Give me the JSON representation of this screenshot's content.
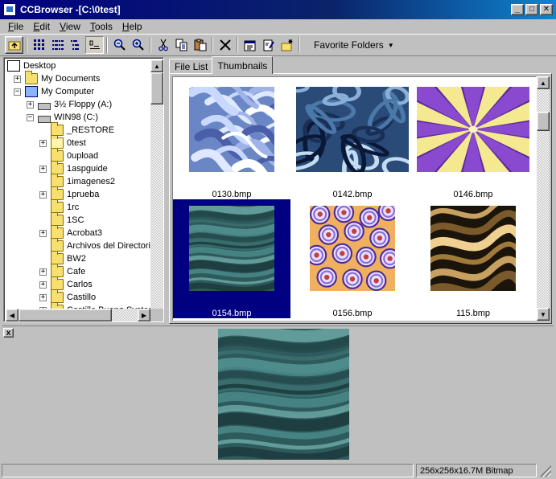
{
  "window": {
    "title": "CCBrowser -[C:\\0test]"
  },
  "caption_buttons": {
    "minimize": "_",
    "maximize": "□",
    "close": "✕"
  },
  "menu": [
    {
      "label": "File",
      "accel": "F",
      "rest": "ile"
    },
    {
      "label": "Edit",
      "accel": "E",
      "rest": "dit"
    },
    {
      "label": "View",
      "accel": "V",
      "rest": "iew"
    },
    {
      "label": "Tools",
      "accel": "T",
      "rest": "ools"
    },
    {
      "label": "Help",
      "accel": "H",
      "rest": "elp"
    }
  ],
  "toolbar": {
    "icons": [
      "up-folder-icon",
      "large-icons-icon",
      "small-icons-icon",
      "list-icon",
      "details-icon",
      "zoom-out-icon",
      "zoom-in-icon",
      "cut-icon",
      "copy-icon",
      "paste-icon",
      "delete-icon",
      "properties-icon",
      "rename-icon",
      "new-folder-icon"
    ],
    "favorites_label": "Favorite Folders"
  },
  "tree": {
    "items": [
      {
        "label": "Desktop",
        "level": 0,
        "expander": "",
        "icon": "desktop-icon"
      },
      {
        "label": "My Documents",
        "level": 1,
        "expander": "+",
        "icon": "folder-icon"
      },
      {
        "label": "My Computer",
        "level": 1,
        "expander": "−",
        "icon": "computer-icon"
      },
      {
        "label": "3½ Floppy (A:)",
        "level": 2,
        "expander": "+",
        "icon": "floppy-icon"
      },
      {
        "label": "WIN98 (C:)",
        "level": 2,
        "expander": "−",
        "icon": "drive-icon"
      },
      {
        "label": "_RESTORE",
        "level": 3,
        "expander": "",
        "icon": "folder-icon"
      },
      {
        "label": "0test",
        "level": 3,
        "expander": "+",
        "icon": "folder-open-icon"
      },
      {
        "label": "0upload",
        "level": 3,
        "expander": "",
        "icon": "folder-icon"
      },
      {
        "label": "1aspguide",
        "level": 3,
        "expander": "+",
        "icon": "folder-icon"
      },
      {
        "label": "1imagenes2",
        "level": 3,
        "expander": "",
        "icon": "folder-icon"
      },
      {
        "label": "1prueba",
        "level": 3,
        "expander": "+",
        "icon": "folder-icon"
      },
      {
        "label": "1rc",
        "level": 3,
        "expander": "",
        "icon": "folder-icon"
      },
      {
        "label": "1SC",
        "level": 3,
        "expander": "",
        "icon": "folder-icon"
      },
      {
        "label": "Acrobat3",
        "level": 3,
        "expander": "+",
        "icon": "folder-icon"
      },
      {
        "label": "Archivos del Directori",
        "level": 3,
        "expander": "",
        "icon": "folder-icon"
      },
      {
        "label": "BW2",
        "level": 3,
        "expander": "",
        "icon": "folder-icon"
      },
      {
        "label": "Cafe",
        "level": 3,
        "expander": "+",
        "icon": "folder-icon"
      },
      {
        "label": "Carlos",
        "level": 3,
        "expander": "+",
        "icon": "folder-icon"
      },
      {
        "label": "Castillo",
        "level": 3,
        "expander": "+",
        "icon": "folder-icon"
      },
      {
        "label": "Castillo Bueno Systen",
        "level": 3,
        "expander": "+",
        "icon": "folder-icon"
      }
    ]
  },
  "tabs": [
    {
      "label": "File List",
      "active": false
    },
    {
      "label": "Thumbnails",
      "active": true
    }
  ],
  "thumbnails": [
    {
      "filename": "0130.bmp",
      "pattern": "swirl-white",
      "selected": false
    },
    {
      "filename": "0142.bmp",
      "pattern": "swirl-blue",
      "selected": false
    },
    {
      "filename": "0146.bmp",
      "pattern": "star-purple",
      "selected": false
    },
    {
      "filename": "0154.bmp",
      "pattern": "teal-marble",
      "selected": true
    },
    {
      "filename": "0156.bmp",
      "pattern": "circles-orange",
      "selected": false
    },
    {
      "filename": "115.bmp",
      "pattern": "gold-waves",
      "selected": false
    }
  ],
  "preview": {
    "close_label": "x"
  },
  "status": {
    "left": "",
    "right": "256x256x16.7M Bitmap"
  },
  "colors": {
    "title_start": "#000080",
    "title_end": "#1084d0",
    "selection": "#000080",
    "face": "#c0c0c0"
  }
}
